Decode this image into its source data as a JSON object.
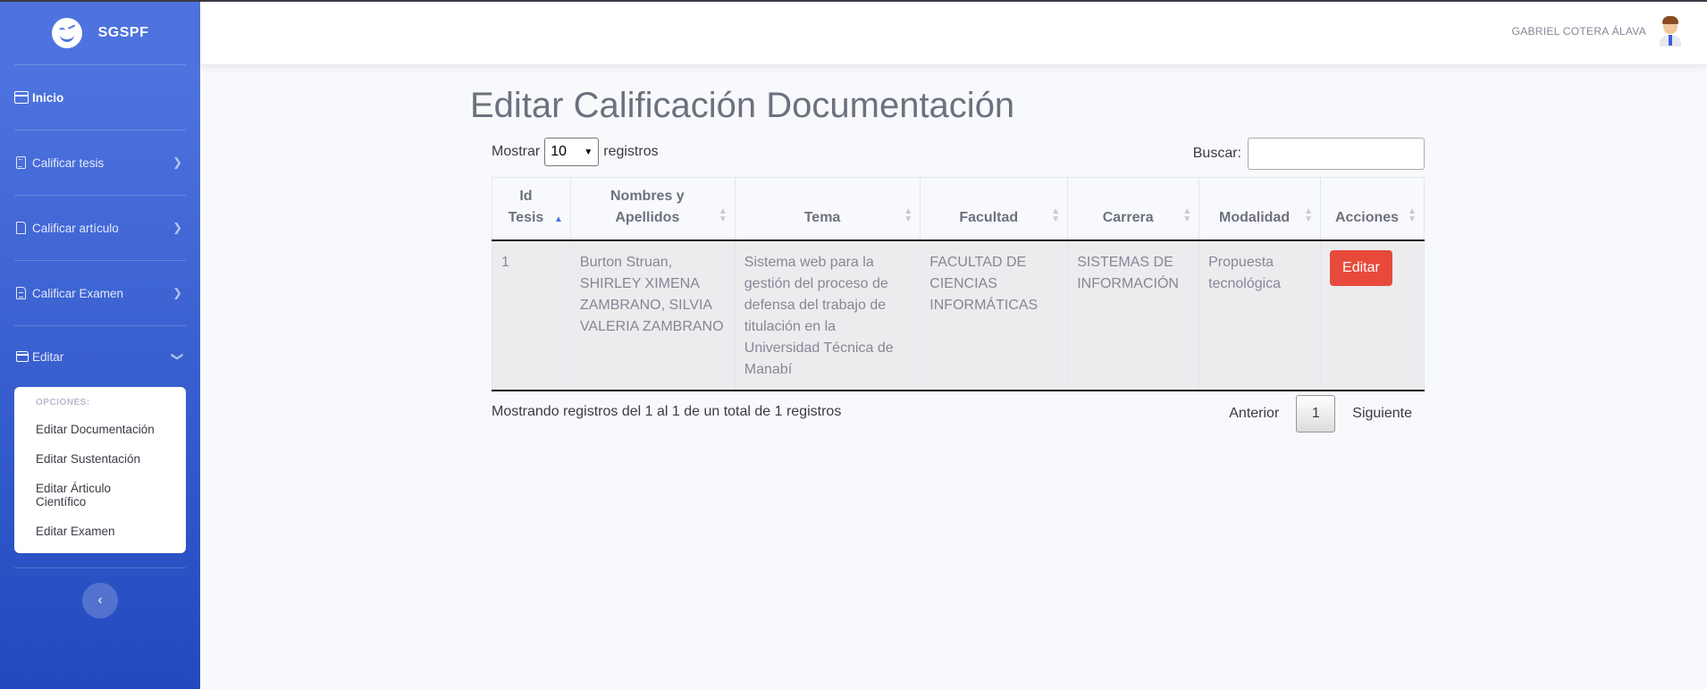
{
  "brand": {
    "name": "SGSPF",
    "logo_icon": "winking-face-icon"
  },
  "sidebar": {
    "items": [
      {
        "label": "Inicio",
        "icon": "window-icon"
      },
      {
        "label": "Calificar tesis",
        "icon": "calculator-icon"
      },
      {
        "label": "Calificar artículo",
        "icon": "file-icon"
      },
      {
        "label": "Calificar Examen",
        "icon": "file-text-icon"
      },
      {
        "label": "Editar",
        "icon": "folder-icon"
      }
    ],
    "submenu": {
      "header": "OPCIONES:",
      "items": [
        "Editar Documentación",
        "Editar Sustentación",
        "Editar Árticulo Científico",
        "Editar Examen"
      ]
    },
    "toggle_glyph": "‹"
  },
  "topbar": {
    "user_name": "GABRIEL COTERA ÁLAVA"
  },
  "page": {
    "title": "Editar Calificación Documentación"
  },
  "datatable": {
    "length_prefix": "Mostrar",
    "length_value": "10",
    "length_suffix": "registros",
    "search_label": "Buscar:",
    "search_value": "",
    "columns": [
      "Id Tesis",
      "Nombres y Apellidos",
      "Tema",
      "Facultad",
      "Carrera",
      "Modalidad",
      "Acciones"
    ],
    "rows": [
      {
        "id": "1",
        "nombres": "Burton Struan, SHIRLEY XIMENA ZAMBRANO, SILVIA VALERIA ZAMBRANO",
        "tema": "Sistema web para la gestión del proceso de defensa del trabajo de titulación en la Universidad Técnica de Manabí",
        "facultad": "FACULTAD DE CIENCIAS INFORMÁTICAS",
        "carrera": "SISTEMAS DE INFORMACIÓN",
        "modalidad": "Propuesta tecnológica",
        "action": "Editar"
      }
    ],
    "info": "Mostrando registros del 1 al 1 de un total de 1 registros",
    "pagination": {
      "previous": "Anterior",
      "current": "1",
      "next": "Siguiente"
    }
  },
  "colors": {
    "sidebar_start": "#4e73df",
    "sidebar_end": "#224abe",
    "danger": "#e74a3b",
    "sort_active": "#4e73df"
  }
}
